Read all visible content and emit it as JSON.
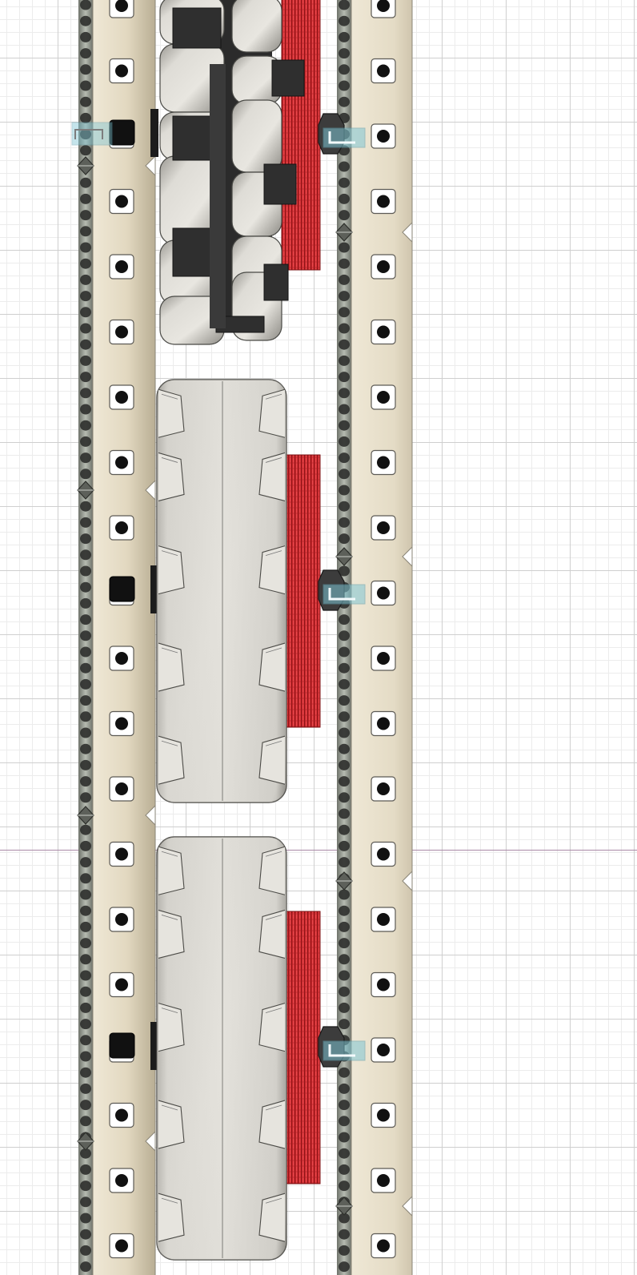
{
  "scene": {
    "view": "top",
    "background": "#ffffff",
    "grid_color": "#cfcfcf",
    "grid_minor_color": "#ececec",
    "axis_color": "#a989a6"
  },
  "parts": {
    "c_channels": {
      "count": 2,
      "color": "#e5dcc6",
      "edge_color": "#6e6b64",
      "hole_color": "#111111",
      "rail_color": "#8a8f86"
    },
    "wheels": [
      {
        "type": "omni-wheel",
        "roller_color": "#d8d6d0",
        "hub_color": "#2b2b2b"
      },
      {
        "type": "traction-wheel",
        "tread_color": "#dad8d2"
      },
      {
        "type": "traction-wheel",
        "tread_color": "#dad8d2"
      }
    ],
    "gears": {
      "count": 3,
      "color": "#c8262a"
    },
    "shaft_collars": {
      "count": 3,
      "color": "#3c3c3c"
    },
    "motors_markers": {
      "count": 3,
      "color": "#2a2a2a"
    },
    "selection_icons": {
      "color": "#7ec5d3"
    }
  }
}
